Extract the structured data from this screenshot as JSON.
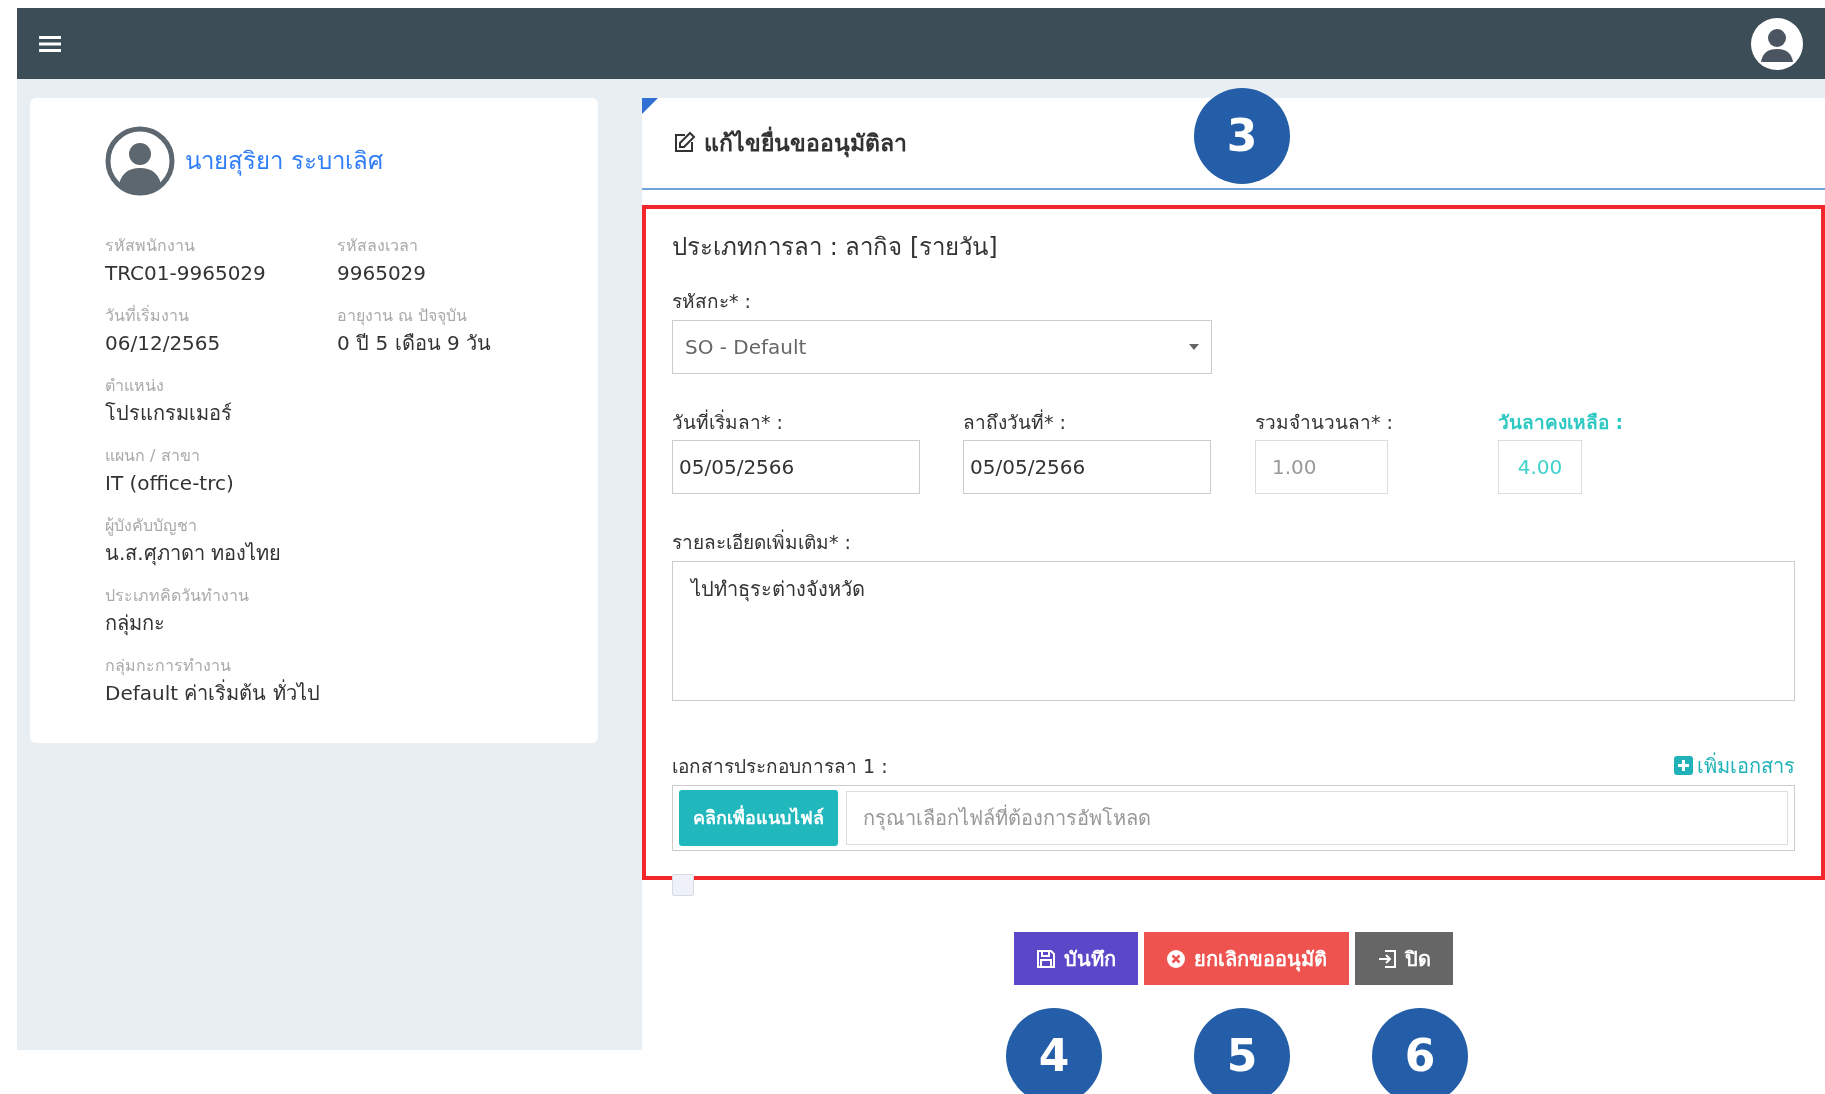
{
  "profile": {
    "name": "นายสุริยา ระบาเลิศ",
    "rows": [
      [
        {
          "label": "รหัสพนักงาน",
          "value": "TRC01-9965029"
        },
        {
          "label": "รหัสลงเวลา",
          "value": "9965029"
        }
      ],
      [
        {
          "label": "วันที่เริ่มงาน",
          "value": "06/12/2565"
        },
        {
          "label": "อายุงาน ณ ปัจจุบัน",
          "value": "0 ปี 5 เดือน 9 วัน"
        }
      ],
      [
        {
          "label": "ตำแหน่ง",
          "value": "โปรแกรมเมอร์"
        }
      ],
      [
        {
          "label": "แผนก / สาขา",
          "value": "IT (office-trc)"
        }
      ],
      [
        {
          "label": "ผู้บังคับบัญชา",
          "value": "น.ส.ศุภาดา ทองไทย"
        }
      ],
      [
        {
          "label": "ประเภทคิดวันทำงาน",
          "value": "กลุ่มกะ"
        }
      ],
      [
        {
          "label": "กลุ่มกะการทำงาน",
          "value": "Default ค่าเริ่มต้น ทั่วไป"
        }
      ]
    ]
  },
  "form": {
    "title": "แก้ไขยื่นขออนุมัติลา",
    "leave_type": "ประเภทการลา : ลากิจ [รายวัน]",
    "shift": {
      "label": "รหัสกะ* :",
      "value": "SO - Default"
    },
    "dates": [
      {
        "label": "วันที่เริ่มลา* :",
        "value": "05/05/2566",
        "kind": "date"
      },
      {
        "label": "ลาถึงวันที่* :",
        "value": "05/05/2566",
        "kind": "date"
      },
      {
        "label": "รวมจำนวนลา* :",
        "value": "1.00",
        "kind": "total"
      },
      {
        "label": "วันลาคงเหลือ :",
        "value": "4.00",
        "kind": "remaining"
      }
    ],
    "details": {
      "label": "รายละเอียดเพิ่มเติม* :",
      "value": "ไปทำธุระต่างจังหวัด"
    },
    "attachment": {
      "label": "เอกสารประกอบการลา 1 :",
      "add_link": "เพิ่มเอกสาร",
      "button": "คลิกเพื่อแนบไฟล์",
      "placeholder": "กรุณาเลือกไฟล์ที่ต้องการอัพโหลด"
    },
    "checkbox": {
      "checked": false
    },
    "buttons": [
      {
        "label": "บันทึก",
        "kind": "save"
      },
      {
        "label": "ยกเลิกขออนุมัติ",
        "kind": "cancel"
      },
      {
        "label": "ปิด",
        "kind": "close"
      }
    ]
  },
  "callouts": [
    {
      "label": "3",
      "kind": "title"
    },
    {
      "label": "4",
      "kind": "save"
    },
    {
      "label": "5",
      "kind": "cancel"
    },
    {
      "label": "6",
      "kind": "close"
    }
  ]
}
